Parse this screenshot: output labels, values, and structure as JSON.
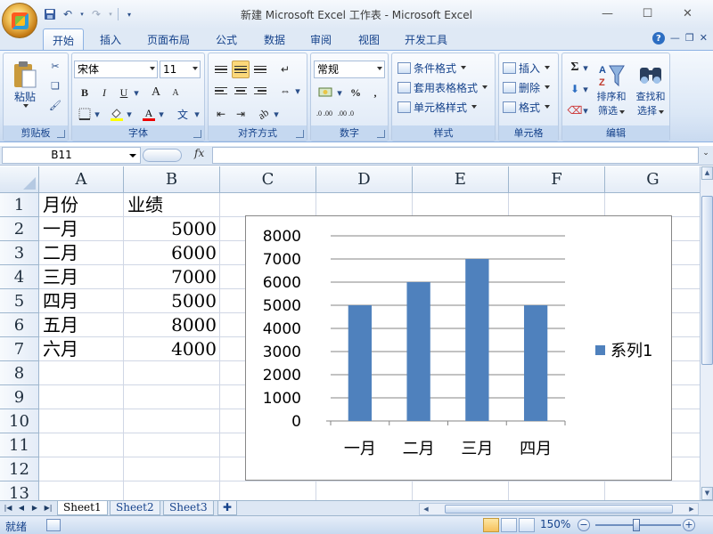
{
  "window": {
    "title": "新建 Microsoft Excel 工作表 - Microsoft Excel",
    "minimize_icon": "minimize-icon",
    "maximize_icon": "maximize-icon",
    "close_icon": "close-icon"
  },
  "ribbon_tabs": [
    "开始",
    "插入",
    "页面布局",
    "公式",
    "数据",
    "审阅",
    "视图",
    "开发工具"
  ],
  "active_tab": "开始",
  "clipboard": {
    "paste_label": "粘贴",
    "group_label": "剪贴板"
  },
  "font": {
    "name": "宋体",
    "size": "11",
    "group_label": "字体",
    "bold": "B",
    "italic": "I",
    "underline": "U",
    "grow": "A",
    "shrink": "A",
    "phonetic": "文"
  },
  "alignment": {
    "group_label": "对齐方式"
  },
  "number": {
    "format": "常规",
    "percent": "%",
    "comma": ",",
    "inc_dec": ".0 .00",
    "dec_dec": ".00 .0",
    "group_label": "数字"
  },
  "styles": {
    "conditional": "条件格式",
    "table_format": "套用表格格式",
    "cell_styles": "单元格样式",
    "group_label": "样式"
  },
  "cells": {
    "insert": "插入",
    "delete": "删除",
    "format": "格式",
    "group_label": "单元格"
  },
  "editing": {
    "sum": "Σ",
    "sort_filter_1": "排序和",
    "sort_filter_2": "筛选",
    "find_select_1": "查找和",
    "find_select_2": "选择",
    "group_label": "编辑"
  },
  "formula_bar": {
    "name_box": "B11",
    "fx": "fx",
    "content": ""
  },
  "grid": {
    "columns": [
      "A",
      "B",
      "C",
      "D",
      "E",
      "F",
      "G"
    ],
    "rows": [
      "1",
      "2",
      "3",
      "4",
      "5",
      "6",
      "7",
      "8",
      "9",
      "10",
      "11",
      "12",
      "13"
    ],
    "data": [
      [
        "月份",
        "业绩"
      ],
      [
        "一月",
        "5000"
      ],
      [
        "二月",
        "6000"
      ],
      [
        "三月",
        "7000"
      ],
      [
        "四月",
        "5000"
      ],
      [
        "五月",
        "8000"
      ],
      [
        "六月",
        "4000"
      ]
    ]
  },
  "chart_data": {
    "type": "bar",
    "categories": [
      "一月",
      "二月",
      "三月",
      "四月"
    ],
    "series": [
      {
        "name": "系列1",
        "values": [
          5000,
          6000,
          7000,
          5000
        ],
        "color": "#4f81bd"
      }
    ],
    "ylim": [
      0,
      8000
    ],
    "yticks": [
      0,
      1000,
      2000,
      3000,
      4000,
      5000,
      6000,
      7000,
      8000
    ],
    "grid": true,
    "legend": "right",
    "title": "",
    "xlabel": "",
    "ylabel": ""
  },
  "sheets": [
    "Sheet1",
    "Sheet2",
    "Sheet3"
  ],
  "active_sheet": "Sheet1",
  "status": {
    "mode": "就绪",
    "zoom": "150%"
  },
  "colors": {
    "accent": "#4f81bd",
    "ribbon": "#dfe9f5",
    "grid_line": "#d0d7e5"
  }
}
